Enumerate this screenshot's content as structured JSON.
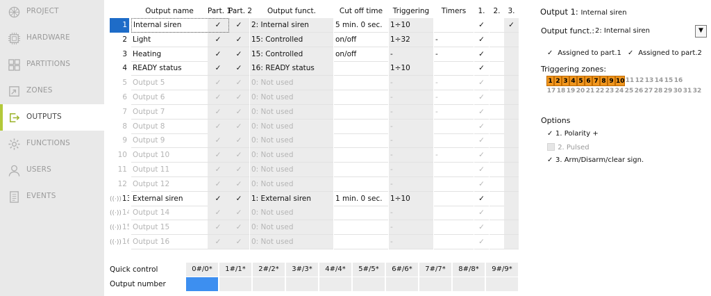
{
  "sidebar": {
    "items": [
      {
        "label": "PROJECT",
        "icon": "project-icon",
        "active": false
      },
      {
        "label": "HARDWARE",
        "icon": "hardware-icon",
        "active": false
      },
      {
        "label": "PARTITIONS",
        "icon": "partitions-icon",
        "active": false
      },
      {
        "label": "ZONES",
        "icon": "zones-icon",
        "active": false
      },
      {
        "label": "OUTPUTS",
        "icon": "outputs-icon",
        "active": true
      },
      {
        "label": "FUNCTIONS",
        "icon": "functions-icon",
        "active": false
      },
      {
        "label": "USERS",
        "icon": "users-icon",
        "active": false
      },
      {
        "label": "EVENTS",
        "icon": "events-icon",
        "active": false
      }
    ]
  },
  "table": {
    "headers": {
      "name": "Output name",
      "p1": "Part. 1",
      "p2": "Part. 2",
      "func": "Output funct.",
      "cut": "Cut off time",
      "trig": "Triggering",
      "timers": "Timers",
      "z1": "1.",
      "z2": "2.",
      "z3": "3."
    },
    "check_glyph": "✓",
    "rows": [
      {
        "num": "1",
        "name": "Internal siren",
        "p1": true,
        "p2": true,
        "func": "2: Internal siren",
        "cut": "5 min. 0 sec.",
        "trig": "1÷10",
        "timers": "",
        "z1": true,
        "z2": false,
        "z3": true,
        "disabled": false,
        "wireless": false,
        "selected": true
      },
      {
        "num": "2",
        "name": "Light",
        "p1": true,
        "p2": true,
        "func": "15: Controlled",
        "cut": "on/off",
        "trig": "1÷32",
        "timers": "-",
        "z1": true,
        "z2": false,
        "z3": false,
        "disabled": false,
        "wireless": false,
        "selected": false
      },
      {
        "num": "3",
        "name": "Heating",
        "p1": true,
        "p2": true,
        "func": "15: Controlled",
        "cut": "on/off",
        "trig": "-",
        "timers": "-",
        "z1": true,
        "z2": false,
        "z3": false,
        "disabled": false,
        "wireless": false,
        "selected": false
      },
      {
        "num": "4",
        "name": "READY status",
        "p1": true,
        "p2": true,
        "func": "16: READY status",
        "cut": "",
        "trig": "1÷10",
        "timers": "",
        "z1": true,
        "z2": false,
        "z3": false,
        "disabled": false,
        "wireless": false,
        "selected": false
      },
      {
        "num": "5",
        "name": "Output  5",
        "p1": true,
        "p2": true,
        "func": "0: Not used",
        "cut": "",
        "trig": "-",
        "timers": "-",
        "z1": true,
        "z2": false,
        "z3": false,
        "disabled": true,
        "wireless": false,
        "selected": false
      },
      {
        "num": "6",
        "name": "Output  6",
        "p1": true,
        "p2": true,
        "func": "0: Not used",
        "cut": "",
        "trig": "-",
        "timers": "-",
        "z1": true,
        "z2": false,
        "z3": false,
        "disabled": true,
        "wireless": false,
        "selected": false
      },
      {
        "num": "7",
        "name": "Output  7",
        "p1": true,
        "p2": true,
        "func": "0: Not used",
        "cut": "",
        "trig": "-",
        "timers": "-",
        "z1": true,
        "z2": false,
        "z3": false,
        "disabled": true,
        "wireless": false,
        "selected": false
      },
      {
        "num": "8",
        "name": "Output  8",
        "p1": true,
        "p2": true,
        "func": "0: Not used",
        "cut": "",
        "trig": "-",
        "timers": "",
        "z1": true,
        "z2": false,
        "z3": false,
        "disabled": true,
        "wireless": false,
        "selected": false
      },
      {
        "num": "9",
        "name": "Output  9",
        "p1": true,
        "p2": true,
        "func": "0: Not used",
        "cut": "",
        "trig": "-",
        "timers": "",
        "z1": true,
        "z2": false,
        "z3": false,
        "disabled": true,
        "wireless": false,
        "selected": false
      },
      {
        "num": "10",
        "name": "Output 10",
        "p1": true,
        "p2": true,
        "func": "0: Not used",
        "cut": "",
        "trig": "-",
        "timers": "-",
        "z1": true,
        "z2": false,
        "z3": false,
        "disabled": true,
        "wireless": false,
        "selected": false
      },
      {
        "num": "11",
        "name": "Output 11",
        "p1": true,
        "p2": true,
        "func": "0: Not used",
        "cut": "",
        "trig": "-",
        "timers": "",
        "z1": true,
        "z2": false,
        "z3": false,
        "disabled": true,
        "wireless": false,
        "selected": false
      },
      {
        "num": "12",
        "name": "Output 12",
        "p1": true,
        "p2": true,
        "func": "0: Not used",
        "cut": "",
        "trig": "-",
        "timers": "",
        "z1": true,
        "z2": false,
        "z3": false,
        "disabled": true,
        "wireless": false,
        "selected": false
      },
      {
        "num": "13",
        "name": "External siren",
        "p1": true,
        "p2": true,
        "func": "1: External siren",
        "cut": "1 min. 0 sec.",
        "trig": "1÷10",
        "timers": "",
        "z1": true,
        "z2": false,
        "z3": false,
        "disabled": false,
        "wireless": true,
        "selected": false
      },
      {
        "num": "14",
        "name": "Output 14",
        "p1": true,
        "p2": true,
        "func": "0: Not used",
        "cut": "",
        "trig": "-",
        "timers": "",
        "z1": true,
        "z2": false,
        "z3": false,
        "disabled": true,
        "wireless": true,
        "selected": false
      },
      {
        "num": "15",
        "name": "Output 15",
        "p1": true,
        "p2": true,
        "func": "0: Not used",
        "cut": "",
        "trig": "-",
        "timers": "",
        "z1": true,
        "z2": false,
        "z3": false,
        "disabled": true,
        "wireless": true,
        "selected": false
      },
      {
        "num": "16",
        "name": "Output 16",
        "p1": true,
        "p2": true,
        "func": "0: Not used",
        "cut": "",
        "trig": "-",
        "timers": "",
        "z1": true,
        "z2": false,
        "z3": false,
        "disabled": true,
        "wireless": true,
        "selected": false
      }
    ]
  },
  "quick_control": {
    "label": "Quick control",
    "row_label": "Output number",
    "buttons": [
      "0#/0*",
      "1#/1*",
      "2#/2*",
      "3#/3*",
      "4#/4*",
      "5#/5*",
      "6#/6*",
      "7#/7*",
      "8#/8*",
      "9#/9*"
    ],
    "selected_index": 0
  },
  "panel": {
    "title_prefix": "Output 1:",
    "title_name": "Internal siren",
    "func_label": "Output funct.:",
    "func_value": "2: Internal siren",
    "assigned_p1": "Assigned to part.1",
    "assigned_p2": "Assigned to part.2",
    "triggering_title": "Triggering zones:",
    "zones_active": 10,
    "zones_total": 32,
    "options_title": "Options",
    "options": [
      {
        "label": "1. Polarity +",
        "checked": true,
        "disabled": false
      },
      {
        "label": "2. Pulsed",
        "checked": false,
        "disabled": true
      },
      {
        "label": "3. Arm/Disarm/clear sign.",
        "checked": true,
        "disabled": false
      }
    ],
    "dropdown_glyph": "▼"
  },
  "colors": {
    "accent": "#b3c93a",
    "selection": "#1e6cc8",
    "zone_on": "#f0961e",
    "qc_selected": "#3d8ff0"
  }
}
